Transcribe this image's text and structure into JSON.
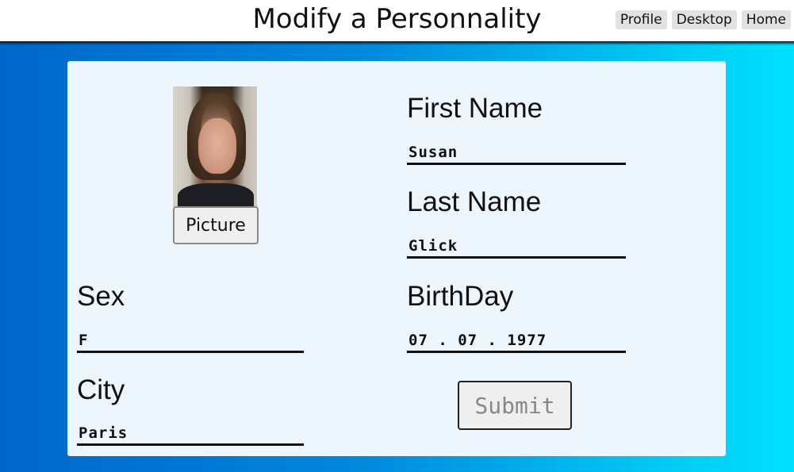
{
  "header": {
    "title": "Modify a Personnality",
    "nav": [
      "Profile",
      "Desktop",
      "Home"
    ]
  },
  "form": {
    "picture_button": "Picture",
    "first_name": {
      "label": "First Name",
      "value": "Susan"
    },
    "last_name": {
      "label": "Last Name",
      "value": "Glick"
    },
    "sex": {
      "label": "Sex",
      "value": "F"
    },
    "birthday": {
      "label": "BirthDay",
      "value": "07 . 07 . 1977"
    },
    "city": {
      "label": "City",
      "value": "Paris"
    },
    "submit": "Submit"
  },
  "colors": {
    "gradient_left": "#0066cc",
    "gradient_right": "#00e0ff",
    "card_background": "#eef6fd"
  }
}
